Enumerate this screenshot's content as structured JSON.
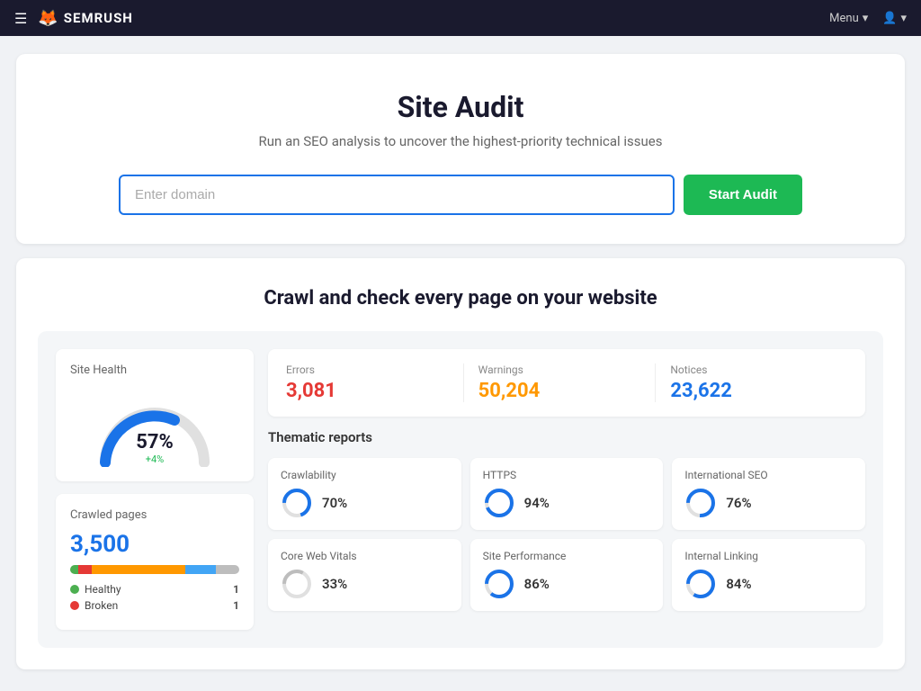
{
  "navbar": {
    "logo_text": "SEMRUSH",
    "menu_label": "Menu",
    "chevron": "▾",
    "user_icon": "👤"
  },
  "hero": {
    "title": "Site Audit",
    "subtitle": "Run an SEO analysis to uncover the highest-priority technical issues",
    "input_placeholder": "Enter domain",
    "cta_label": "Start Audit"
  },
  "demo": {
    "section_title": "Crawl and check every page on your website",
    "site_health": {
      "label": "Site Health",
      "percent": "57%",
      "change": "+4%"
    },
    "crawled": {
      "label": "Crawled pages",
      "count": "3,500"
    },
    "legend": [
      {
        "label": "Healthy",
        "color": "#4caf50",
        "count": "1"
      },
      {
        "label": "Broken",
        "color": "#e53935",
        "count": "1"
      }
    ],
    "metrics": {
      "errors": {
        "label": "Errors",
        "value": "3,081"
      },
      "warnings": {
        "label": "Warnings",
        "value": "50,204"
      },
      "notices": {
        "label": "Notices",
        "value": "23,622"
      }
    },
    "thematic_label": "Thematic reports",
    "reports": [
      {
        "title": "Crawlability",
        "percent": "70%",
        "color": "#1a73e8",
        "pct": 70
      },
      {
        "title": "HTTPS",
        "percent": "94%",
        "color": "#1a73e8",
        "pct": 94
      },
      {
        "title": "International SEO",
        "percent": "76%",
        "color": "#1a73e8",
        "pct": 76
      },
      {
        "title": "Core Web Vitals",
        "percent": "33%",
        "color": "#bdbdbd",
        "pct": 33
      },
      {
        "title": "Site Performance",
        "percent": "86%",
        "color": "#1a73e8",
        "pct": 86
      },
      {
        "title": "Internal Linking",
        "percent": "84%",
        "color": "#1a73e8",
        "pct": 84
      }
    ]
  }
}
